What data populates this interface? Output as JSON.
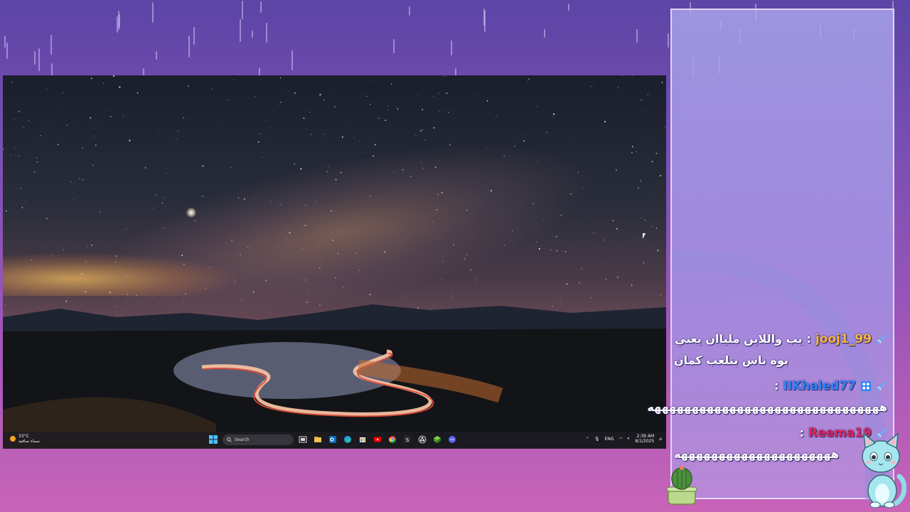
{
  "taskbar": {
    "weather_temp": "33°C",
    "weather_desc": "سماء صافية",
    "search_placeholder": "Search",
    "language": "ENG",
    "time": "2:39 AM",
    "date": "8/1/2025"
  },
  "chat": {
    "messages": [
      {
        "username": "jooj1_99",
        "username_color": "#f5b83d",
        "text_line1": "يب واللاين ملياان يعني",
        "text_line2": "بوه ناس بتلعب كمان",
        "badges": [
          "sword-icon"
        ]
      },
      {
        "username": "IIKhaled77",
        "username_color": "#2f86ff",
        "text_line1": "",
        "text_line2": "هههههههههههههههههههههههههههههههه",
        "badges": [
          "sword-icon",
          "prime-badge-icon"
        ]
      },
      {
        "username": "Reema19",
        "username_color": "#e0285e",
        "text_line1": "",
        "text_line2": "هههههههههههههههههههههه",
        "badges": [
          "sword-icon"
        ]
      }
    ]
  },
  "colors": {
    "background_top": "#5b45a6",
    "background_bottom": "#c963b8",
    "chat_panel": "#aaa5eb"
  }
}
